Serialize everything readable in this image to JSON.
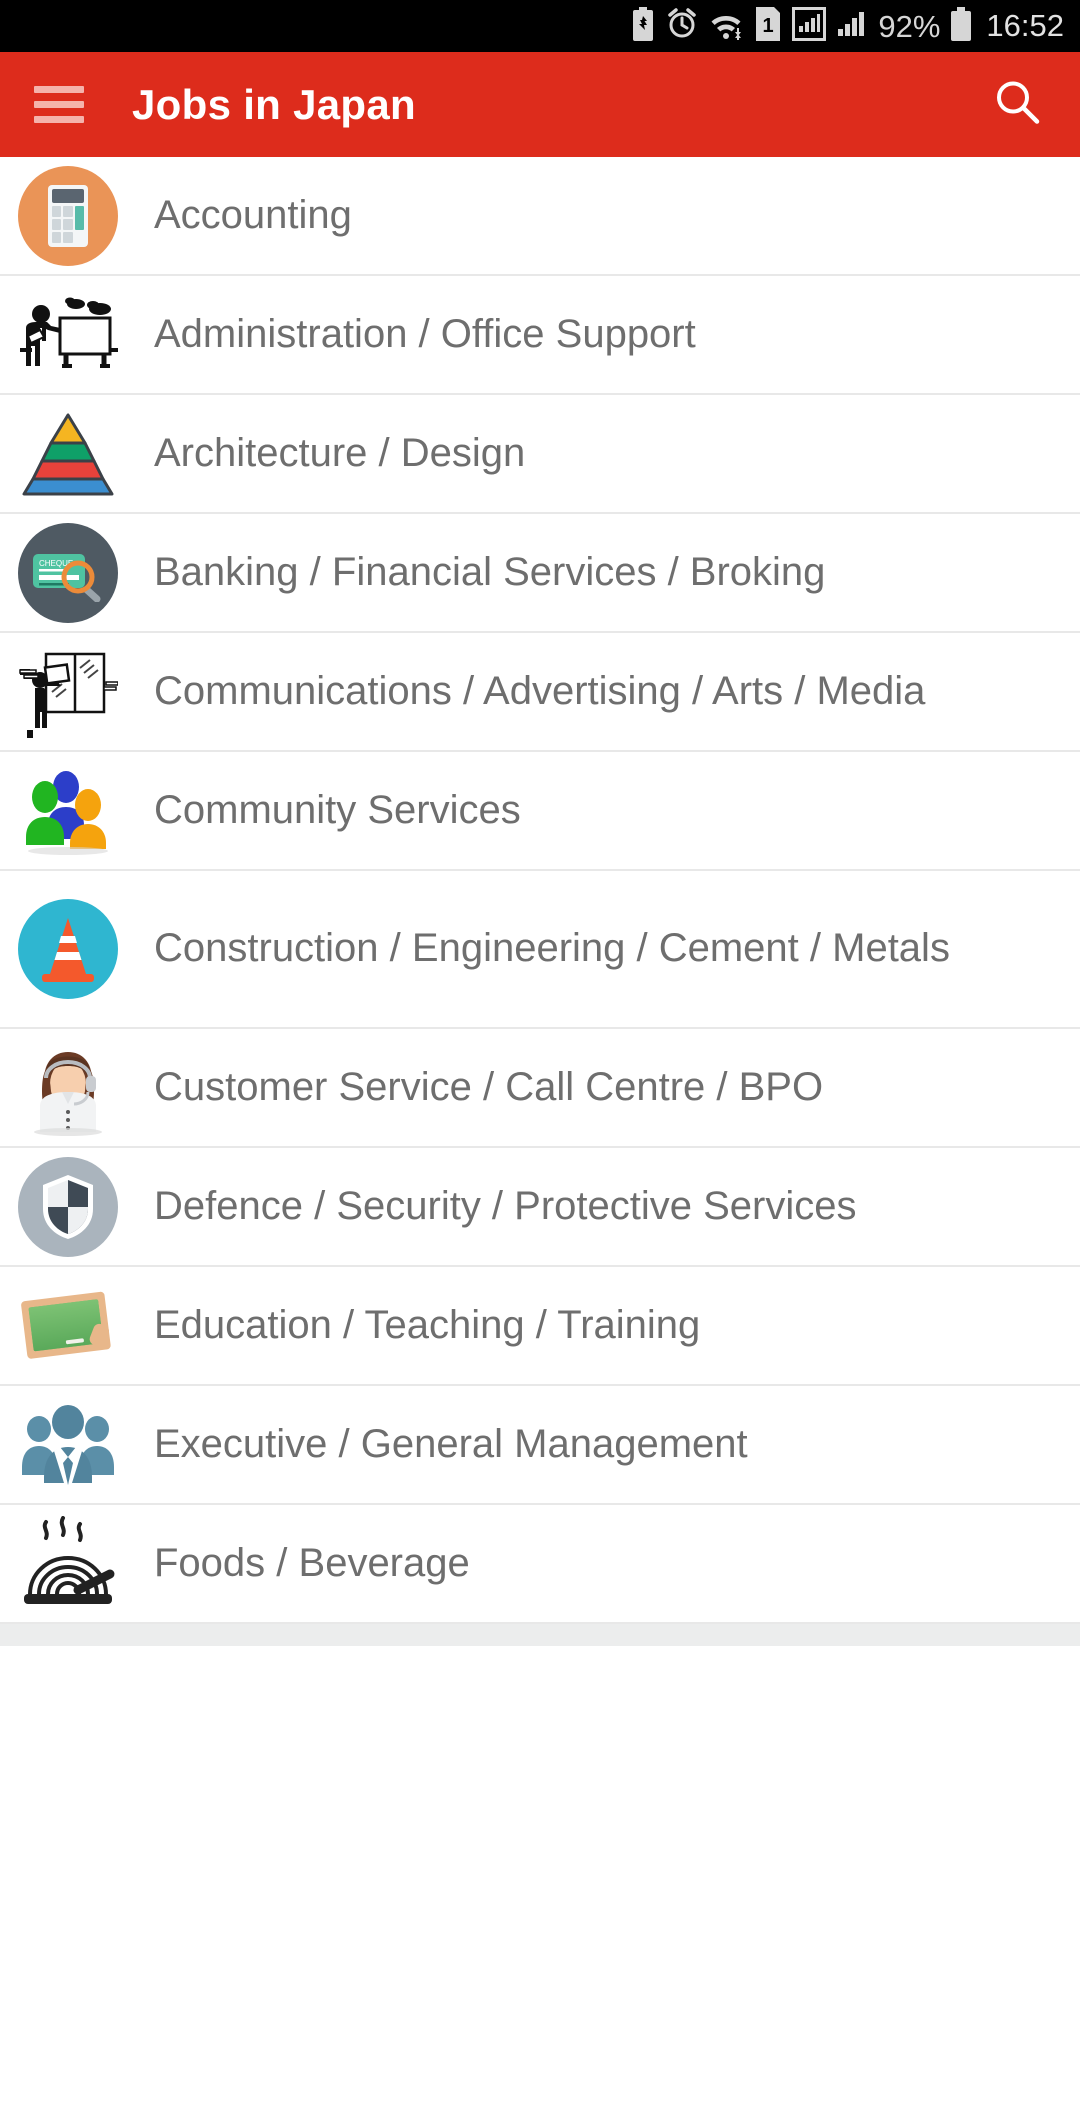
{
  "status_bar": {
    "icons": [
      "battery-saver-icon",
      "alarm-icon",
      "wifi-icon",
      "sim-1-icon",
      "signal-boxed-icon",
      "signal-bars-icon"
    ],
    "sim_label": "1",
    "battery_percent": "92%",
    "clock": "16:52"
  },
  "app_bar": {
    "menu_icon": "hamburger-menu-icon",
    "title": "Jobs in Japan",
    "search_icon": "search-icon",
    "background_color": "#dd2c1c",
    "title_color": "#ffffff"
  },
  "categories": [
    {
      "label": "Accounting",
      "icon": "calculator-icon"
    },
    {
      "label": "Administration / Office Support",
      "icon": "presenter-whiteboard-icon"
    },
    {
      "label": "Architecture / Design",
      "icon": "pyramid-icon"
    },
    {
      "label": "Banking / Financial Services / Broking",
      "icon": "cheque-magnifier-icon"
    },
    {
      "label": "Communications / Advertising / Arts / Media",
      "icon": "poster-hanging-icon"
    },
    {
      "label": "Community Services",
      "icon": "people-group-color-icon"
    },
    {
      "label": "Construction / Engineering / Cement / Metals",
      "icon": "traffic-cone-icon"
    },
    {
      "label": "Customer Service / Call Centre / BPO",
      "icon": "headset-agent-icon"
    },
    {
      "label": "Defence / Security / Protective Services",
      "icon": "shield-icon"
    },
    {
      "label": "Education / Teaching / Training",
      "icon": "chalkboard-icon"
    },
    {
      "label": "Executive / General Management",
      "icon": "business-people-icon"
    },
    {
      "label": "Foods / Beverage",
      "icon": "noodle-bowl-icon"
    }
  ],
  "colors": {
    "accent_red": "#dd2c1c",
    "list_text": "#6e6e6e",
    "divider": "#e8e8e8",
    "status_bar_bg": "#000000"
  }
}
